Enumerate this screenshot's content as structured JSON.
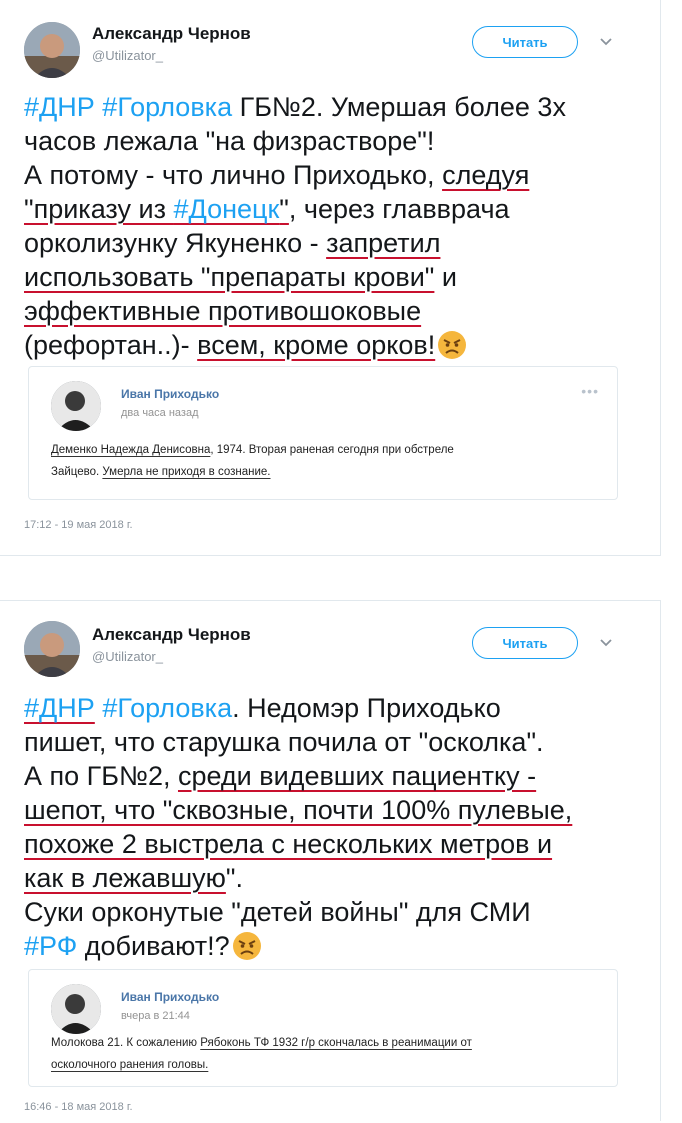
{
  "tweets": [
    {
      "author": "Александр Чернов",
      "handle": "@Utilizator_",
      "follow_label": "Читать",
      "lines": [
        [
          {
            "t": "#ДНР #Горловка",
            "tag": true
          },
          {
            "t": " ГБ№2. Умершая более 3х"
          }
        ],
        [
          {
            "t": "часов лежала \"на физрастворе\"!"
          }
        ],
        [
          {
            "t": "А потому - что лично Приходько, "
          },
          {
            "t": "следуя",
            "ul": true
          }
        ],
        [
          {
            "t": "\"приказу из ",
            "ul": true
          },
          {
            "t": "#Донецк",
            "tag": true,
            "ul": true
          },
          {
            "t": "\"",
            "ul": true
          },
          {
            "t": ", через главврача"
          }
        ],
        [
          {
            "t": "орколизунку Якуненко - "
          },
          {
            "t": "запретил",
            "ul": true
          }
        ],
        [
          {
            "t": "использовать \"препараты крови\"",
            "ul": true
          },
          {
            "t": " и"
          }
        ],
        [
          {
            "t": "эффективные противошоковые",
            "ul": true
          }
        ],
        [
          {
            "t": "(рефортан..)- "
          },
          {
            "t": "всем, кроме орков!",
            "ul": true
          }
        ]
      ],
      "quote": {
        "author": "Иван Приходько",
        "time": "два часа назад",
        "dots": "•••",
        "lines": [
          [
            {
              "t": "Деменко Надежда Денисовна",
              "ul": true
            },
            {
              "t": ", 1974. Вторая раненая сегодня при обстреле"
            }
          ],
          [
            {
              "t": "Зайцево. "
            },
            {
              "t": "Умерла не приходя в сознание.",
              "ul": true
            }
          ]
        ]
      },
      "timestamp": "17:12 - 19 мая 2018 г."
    },
    {
      "author": "Александр Чернов",
      "handle": "@Utilizator_",
      "follow_label": "Читать",
      "lines": [
        [
          {
            "t": "#ДНР",
            "tag": true,
            "ul": true
          },
          {
            "t": " "
          },
          {
            "t": "#Горловка",
            "tag": true
          },
          {
            "t": ". Недомэр Приходько"
          }
        ],
        [
          {
            "t": "пишет, что старушка почила от \"осколка\"."
          }
        ],
        [
          {
            "t": "А по ГБ№2, "
          },
          {
            "t": "среди видевших пациентку -",
            "ul": true
          }
        ],
        [
          {
            "t": "шепот, что \"сквозные, почти 100% пулевые,",
            "ul": true
          }
        ],
        [
          {
            "t": "похоже 2 выстрела с нескольких метров и",
            "ul": true
          }
        ],
        [
          {
            "t": "как в лежавшую",
            "ul": true
          },
          {
            "t": "\"."
          }
        ],
        [
          {
            "t": "Суки орконутые \"детей войны\" для СМИ"
          }
        ],
        [
          {
            "t": "#РФ",
            "tag": true
          },
          {
            "t": " добивают!?"
          }
        ]
      ],
      "quote": {
        "author": "Иван Приходько",
        "time": "вчера в 21:44",
        "dots": "",
        "lines": [
          [
            {
              "t": "Молокова 21. К сожалению "
            },
            {
              "t": "Рябоконь ТФ 1932 г/р скончалась в реанимации от",
              "ul": true
            }
          ],
          [
            {
              "t": "осколочного ранения головы.",
              "ul": true
            }
          ]
        ]
      },
      "timestamp": "16:46 - 18 мая 2018 г."
    }
  ],
  "icons": {
    "emoji": "angry-face-icon",
    "chevron": "chevron-down-icon"
  },
  "colors": {
    "link": "#1da1f2",
    "underline": "#c8102e",
    "vk_name": "#4a76a8"
  }
}
